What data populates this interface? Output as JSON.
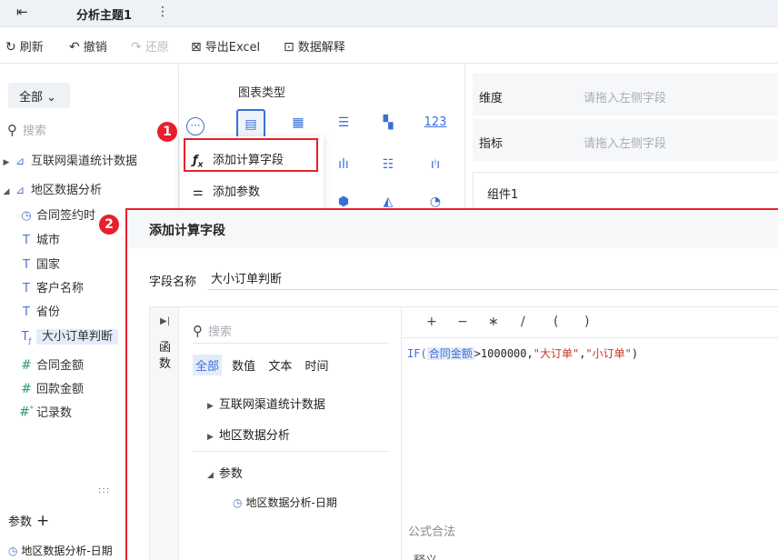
{
  "tabbar": {
    "tab_title": "分析主题1",
    "more": "⋮"
  },
  "toolbar": {
    "refresh": "刷新",
    "undo": "撤销",
    "redo": "还原",
    "export": "导出Excel",
    "explain": "数据解释"
  },
  "left": {
    "scope": "全部",
    "search_placeholder": "搜索",
    "tree": [
      {
        "label": "互联网渠道统计数据",
        "type": "folder",
        "expanded": false
      },
      {
        "label": "地区数据分析",
        "type": "folder",
        "expanded": true
      },
      {
        "label": "合同签约时",
        "type": "date"
      },
      {
        "label": "城市",
        "type": "text"
      },
      {
        "label": "国家",
        "type": "text"
      },
      {
        "label": "客户名称",
        "type": "text"
      },
      {
        "label": "省份",
        "type": "text"
      },
      {
        "label": "大小订单判断",
        "type": "calc-text",
        "selected": true
      },
      {
        "label": "合同金额",
        "type": "number"
      },
      {
        "label": "回款金额",
        "type": "number"
      },
      {
        "label": "记录数",
        "type": "count"
      }
    ],
    "drag_handle": ":::",
    "params_label": "参数",
    "params_add": "+",
    "param_item": "地区数据分析-日期"
  },
  "badges": {
    "one": "1",
    "two": "2"
  },
  "menu": {
    "items": [
      {
        "icon": "fx",
        "label": "添加计算字段"
      },
      {
        "icon": "sliders",
        "label": "添加参数"
      }
    ]
  },
  "chart_panel": {
    "title": "图表类型",
    "types_row1": [
      "table",
      "cross-table",
      "detail",
      "kpi",
      "123"
    ],
    "number_type_label": "123"
  },
  "dims": {
    "dimension_label": "维度",
    "dimension_placeholder": "请拖入左侧字段",
    "metric_label": "指标",
    "metric_placeholder": "请拖入左侧字段",
    "component": "组件1"
  },
  "dialog": {
    "title": "添加计算字段",
    "field_name_label": "字段名称",
    "field_name_value": "大小订单判断",
    "vtab_label": "函数",
    "search_placeholder": "搜索",
    "filters": [
      "全部",
      "数值",
      "文本",
      "时间"
    ],
    "groups": [
      "互联网渠道统计数据",
      "地区数据分析"
    ],
    "param_group": "参数",
    "param_item": "地区数据分析-日期",
    "operators": [
      "+",
      "−",
      "∗",
      "/",
      "(",
      ")"
    ],
    "formula": {
      "fn": "IF(",
      "field": "合同金额",
      "op": ">1000000,",
      "s1": "\"大订单\"",
      "comma": ",",
      "s2": "\"小订单\"",
      "close": ")"
    },
    "valid_text": "公式合法",
    "help_label": "释义"
  },
  "colors": {
    "accent": "#3a6fd8",
    "highlight_red": "#e8202c"
  }
}
